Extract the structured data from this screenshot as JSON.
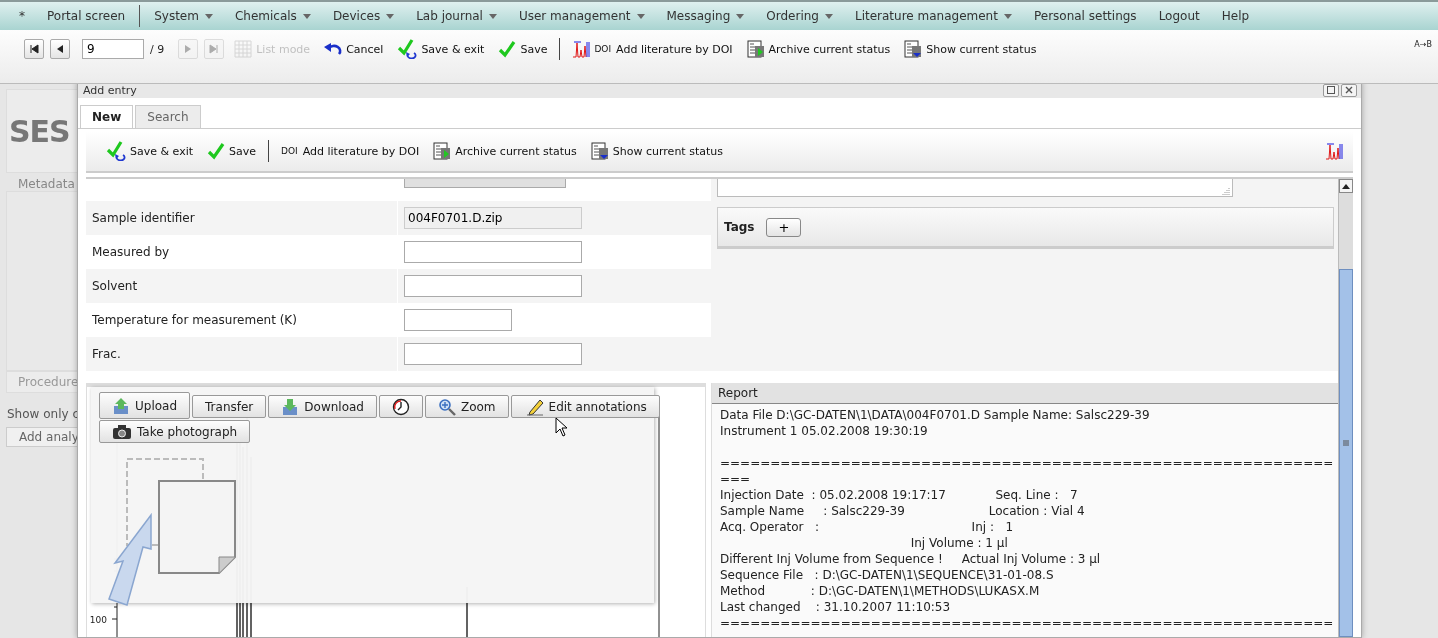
{
  "menu": [
    {
      "kind": "link",
      "label": "*"
    },
    {
      "kind": "link",
      "label": "Portal screen"
    },
    {
      "kind": "separator"
    },
    {
      "kind": "dropdown",
      "label": "System"
    },
    {
      "kind": "dropdown",
      "label": "Chemicals"
    },
    {
      "kind": "dropdown",
      "label": "Devices"
    },
    {
      "kind": "dropdown",
      "label": "Lab journal"
    },
    {
      "kind": "dropdown",
      "label": "User management"
    },
    {
      "kind": "dropdown",
      "label": "Messaging"
    },
    {
      "kind": "dropdown",
      "label": "Ordering"
    },
    {
      "kind": "dropdown",
      "label": "Literature management"
    },
    {
      "kind": "link",
      "label": "Personal settings"
    },
    {
      "kind": "link",
      "label": "Logout"
    },
    {
      "kind": "link",
      "label": "Help"
    }
  ],
  "toolbar": {
    "items": [
      {
        "kind": "first",
        "disabled": false
      },
      {
        "kind": "prev",
        "disabled": false
      },
      {
        "kind": "page_field",
        "value": "9"
      },
      {
        "kind": "page_total",
        "label": "/ 9"
      },
      {
        "kind": "next",
        "disabled": true
      },
      {
        "kind": "last",
        "disabled": true
      },
      {
        "kind": "list_mode",
        "label": "List mode",
        "disabled": true
      },
      {
        "kind": "cancel",
        "label": "Cancel",
        "disabled": false
      },
      {
        "kind": "save_exit",
        "label": "Save & exit",
        "disabled": false
      },
      {
        "kind": "save",
        "label": "Save",
        "disabled": false
      },
      {
        "kind": "separator"
      },
      {
        "kind": "doi_chart",
        "prefix": "DOI",
        "label": "Add literature by DOI",
        "disabled": false
      },
      {
        "kind": "archive",
        "label": "Archive current status",
        "disabled": false
      },
      {
        "kind": "show",
        "label": "Show current status",
        "disabled": false
      }
    ],
    "corner_label": "A→B"
  },
  "page": {
    "title": "SES",
    "metadata_label": "Metadata",
    "procedure_label": "Procedure",
    "filter_text": "Show only c",
    "add_button": "Add analy"
  },
  "dialog": {
    "title": "Add entry",
    "tabs": [
      {
        "label": "New",
        "selected": true
      },
      {
        "label": "Search",
        "selected": false
      }
    ],
    "toolbar": {
      "items": [
        {
          "kind": "save_exit",
          "label": "Save & exit",
          "disabled": false
        },
        {
          "kind": "save",
          "label": "Save",
          "disabled": false
        },
        {
          "kind": "separator"
        },
        {
          "kind": "doi",
          "prefix": "DOI",
          "label": "Add literature by DOI",
          "disabled": false
        },
        {
          "kind": "archive",
          "label": "Archive current status",
          "disabled": false
        },
        {
          "kind": "show",
          "label": "Show current status",
          "disabled": false
        },
        {
          "kind": "spectrum",
          "disabled": false
        }
      ]
    },
    "form": {
      "rows": [
        {
          "label": "Sample identifier",
          "kind": "readonly",
          "value": "004F0701.D.zip"
        },
        {
          "label": "Measured by",
          "kind": "text"
        },
        {
          "label": "Solvent",
          "kind": "text"
        },
        {
          "label": "Temperature for measurement (K)",
          "kind": "short_text"
        },
        {
          "label": "Frac.",
          "kind": "text"
        }
      ]
    },
    "tags": {
      "label": "Tags",
      "add_button": "+"
    },
    "chart_panel": {
      "y_tick_label": "100",
      "button_rows": [
        [
          {
            "kind": "upload",
            "label": "Upload"
          },
          {
            "kind": "plain",
            "label": "Transfer"
          },
          {
            "kind": "download",
            "label": "Download"
          },
          {
            "kind": "clock"
          },
          {
            "kind": "zoom",
            "label": "Zoom"
          },
          {
            "kind": "edit",
            "label": "Edit annotations"
          }
        ],
        [
          {
            "kind": "camera",
            "label": "Take photograph"
          }
        ]
      ]
    },
    "report": {
      "title": "Report",
      "text": "Data File D:\\GC-DATEN\\1\\DATA\\004F0701.D Sample Name: Salsc229-39\nInstrument 1 05.02.2008 19:30:19\n\n=============================================================\n===\nInjection Date  : 05.02.2008 19:17:17             Seq. Line :   7\nSample Name     : Salsc229-39                      Location : Vial 4\nAcq. Operator   :                                        Inj :   1\n                                                  Inj Volume : 1 µl\nDifferent Inj Volume from Sequence !     Actual Inj Volume : 3 µl\nSequence File   : D:\\GC-DATEN\\1\\SEQUENCE\\31-01-08.S\nMethod            : D:\\GC-DATEN\\1\\METHODS\\LUKASX.M\nLast changed    : 31.10.2007 11:10:53\n============================================================="
    }
  }
}
